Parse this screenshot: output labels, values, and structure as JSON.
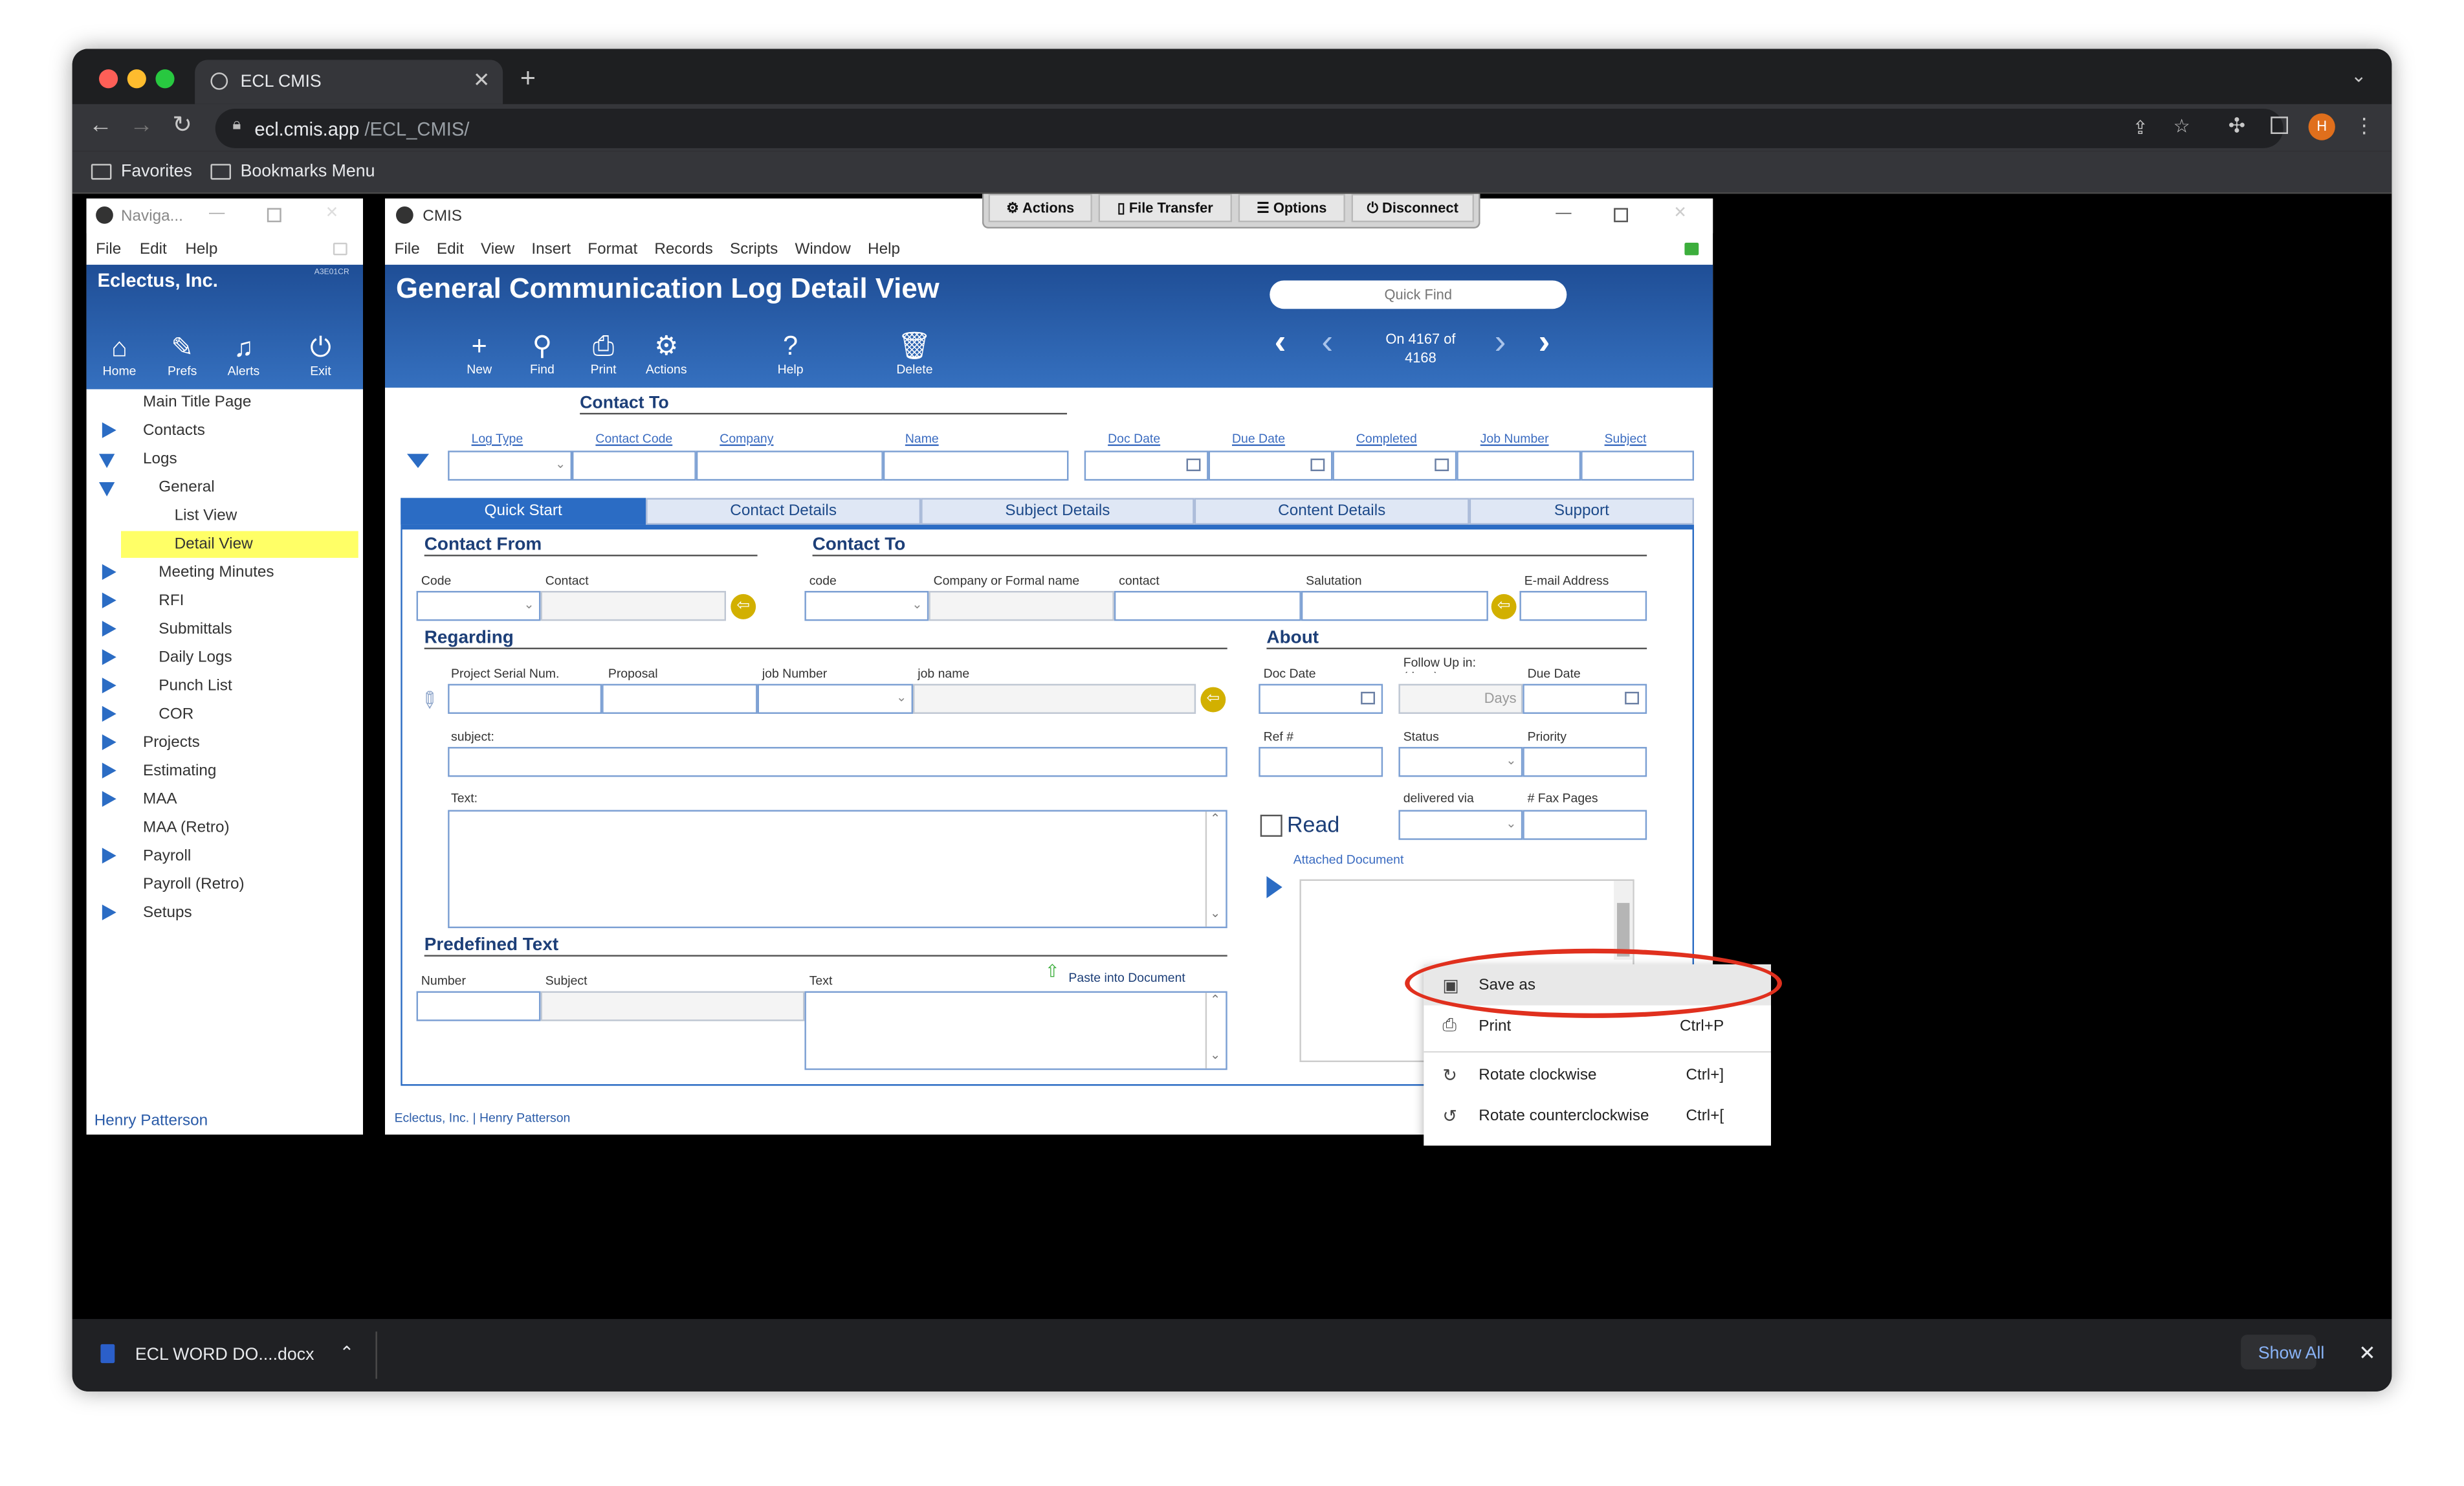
{
  "browser": {
    "tab_title": "ECL CMIS",
    "url_domain": "ecl.cmis.app",
    "url_path": "/ECL_CMIS/",
    "profile_initial": "H",
    "bookmarks": [
      "Favorites",
      "Bookmarks Menu"
    ]
  },
  "float_toolbar": {
    "actions": "Actions",
    "file_transfer": "File Transfer",
    "options": "Options",
    "disconnect": "Disconnect"
  },
  "nav_window": {
    "title": "Naviga...",
    "menu": [
      "File",
      "Edit",
      "Help"
    ],
    "company": "Eclectus, Inc.",
    "code": "A3E01CR",
    "icons": [
      {
        "label": "Home",
        "icon": "home-icon"
      },
      {
        "label": "Prefs",
        "icon": "prefs-icon"
      },
      {
        "label": "Alerts",
        "icon": "bell-icon"
      },
      {
        "label": "Exit",
        "icon": "power-icon"
      }
    ],
    "tree": [
      "Main Title Page",
      "Contacts",
      "Logs",
      "General",
      "List View",
      "Detail View",
      "Meeting Minutes",
      "RFI",
      "Submittals",
      "Daily Logs",
      "Punch List",
      "COR",
      "Projects",
      "Estimating",
      "MAA",
      "MAA (Retro)",
      "Payroll",
      "Payroll (Retro)",
      "Setups"
    ],
    "user": "Henry Patterson"
  },
  "cmis": {
    "title": "CMIS",
    "menu": [
      "File",
      "Edit",
      "View",
      "Insert",
      "Format",
      "Records",
      "Scripts",
      "Window",
      "Help"
    ],
    "heading": "General Communication Log Detail View",
    "quick_find_placeholder": "Quick Find",
    "tools": [
      "New",
      "Find",
      "Print",
      "Actions",
      "Help",
      "Delete"
    ],
    "record_pos": "On 4167 of",
    "record_total": "4168",
    "contact_to_header": "Contact To",
    "columns": [
      "Log Type",
      "Contact Code",
      "Company",
      "Name",
      "Doc Date",
      "Due Date",
      "Completed",
      "Job Number",
      "Subject"
    ],
    "tabs": [
      "Quick Start",
      "Contact Details",
      "Subject Details",
      "Content Details",
      "Support"
    ],
    "contact_from": {
      "title": "Contact From",
      "code": "Code",
      "contact": "Contact"
    },
    "contact_to": {
      "title": "Contact To",
      "code": "code",
      "company": "Company or Formal name",
      "contact": "contact",
      "salutation": "Salutation",
      "email": "E-mail Address"
    },
    "regarding": {
      "title": "Regarding",
      "serial": "Project Serial Num.",
      "proposal": "Proposal",
      "job_number": "job Number",
      "job_name": "job name",
      "subject": "subject:",
      "text": "Text:"
    },
    "about": {
      "title": "About",
      "doc_date": "Doc Date",
      "follow_up": "Follow Up in: (days)",
      "days": "Days",
      "due_date": "Due Date",
      "ref": "Ref #",
      "status": "Status",
      "priority": "Priority",
      "delivered": "delivered via",
      "fax": "# Fax Pages",
      "read": "Read",
      "attached": "Attached Document"
    },
    "predefined": {
      "title": "Predefined Text",
      "number": "Number",
      "subject": "Subject",
      "text": "Text",
      "paste": "Paste into Document"
    },
    "footer": "Eclectus, Inc. | Henry Patterson"
  },
  "context_menu": [
    {
      "label": "Save as",
      "shortcut": "",
      "icon": "save-icon"
    },
    {
      "label": "Print",
      "shortcut": "Ctrl+P",
      "icon": "printer-icon"
    },
    {
      "label": "Rotate clockwise",
      "shortcut": "Ctrl+]",
      "icon": "rotate-cw-icon"
    },
    {
      "label": "Rotate counterclockwise",
      "shortcut": "Ctrl+[",
      "icon": "rotate-ccw-icon"
    }
  ],
  "downloads": {
    "file": "ECL WORD DO....docx",
    "show_all": "Show All"
  },
  "colors": {
    "accent": "#2b6cc4",
    "highlight": "#ffff66",
    "annotation": "#e0301e",
    "arrow_badge": "#d2b000"
  }
}
